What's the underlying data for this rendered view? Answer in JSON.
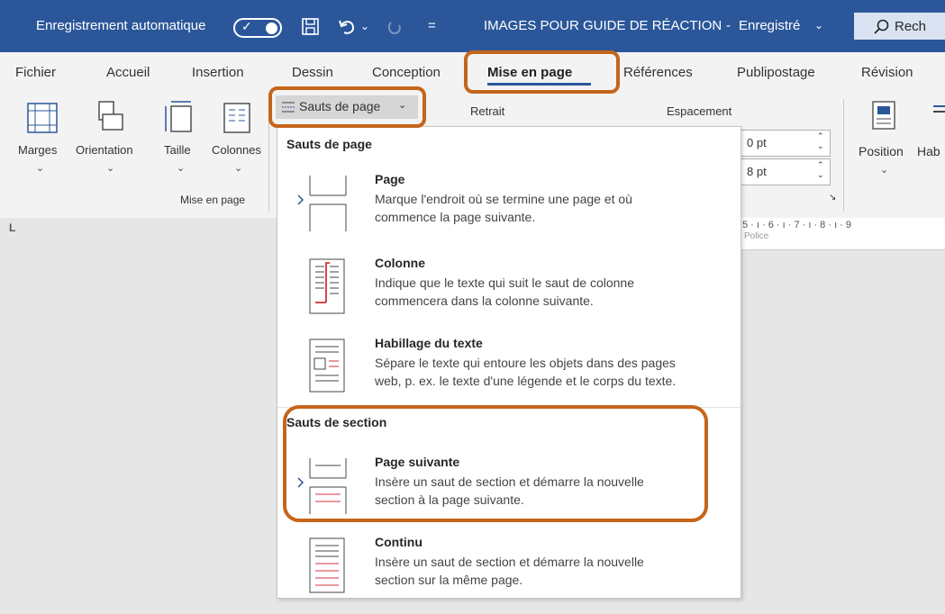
{
  "titlebar": {
    "autosave_label": "Enregistrement automatique",
    "toggle_check": "✓",
    "doc_title": "IMAGES POUR GUIDE DE RÉACTION",
    "separator": "-",
    "save_status": "Enregistré",
    "save_caret": "⌄",
    "search_text": "Rech",
    "undo_caret": "⌄",
    "qat_more": "="
  },
  "tabs": [
    "Fichier",
    "Accueil",
    "Insertion",
    "Dessin",
    "Conception",
    "Mise en page",
    "Références",
    "Publipostage",
    "Révision"
  ],
  "ribbon": {
    "marges": "Marges",
    "orientation": "Orientation",
    "taille": "Taille",
    "colonnes": "Colonnes",
    "sauts_button": "Sauts de page",
    "sauts_caret": "⌄",
    "group_label": "Mise en page",
    "retrait": "Retrait",
    "espacement": "Espacement",
    "spacing_before": "0 pt",
    "spacing_after": "8 pt",
    "position": "Position",
    "hab": "Hab",
    "ruler_text": "5 · ı · 6 · ı · 7 · ı · 8 · ı · 9",
    "ruler_partial": "Police",
    "tab_stop": "L"
  },
  "menu": {
    "header1": "Sauts de page",
    "header2": "Sauts de section",
    "items": [
      {
        "title": "Page",
        "d1": "Marque l'endroit où se termine une page et où",
        "d2": "commence la page suivante."
      },
      {
        "title": "Colonne",
        "d1": "Indique que le texte qui suit le saut de colonne",
        "d2": "commencera dans la colonne suivante."
      },
      {
        "title": "Habillage du texte",
        "d1": "Sépare le texte qui entoure les objets dans des pages",
        "d2": "web, p. ex. le texte d'une légende et le corps du texte."
      },
      {
        "title": "Page suivante",
        "d1": "Insère un saut de section et démarre la nouvelle",
        "d2": "section à la page suivante."
      },
      {
        "title": "Continu",
        "d1": "Insère un saut de section et démarre la nouvelle",
        "d2": "section sur la même page."
      }
    ]
  },
  "colors": {
    "titlebar": "#2b579a",
    "highlight": "#c5651b",
    "accent_red": "#d13438"
  }
}
